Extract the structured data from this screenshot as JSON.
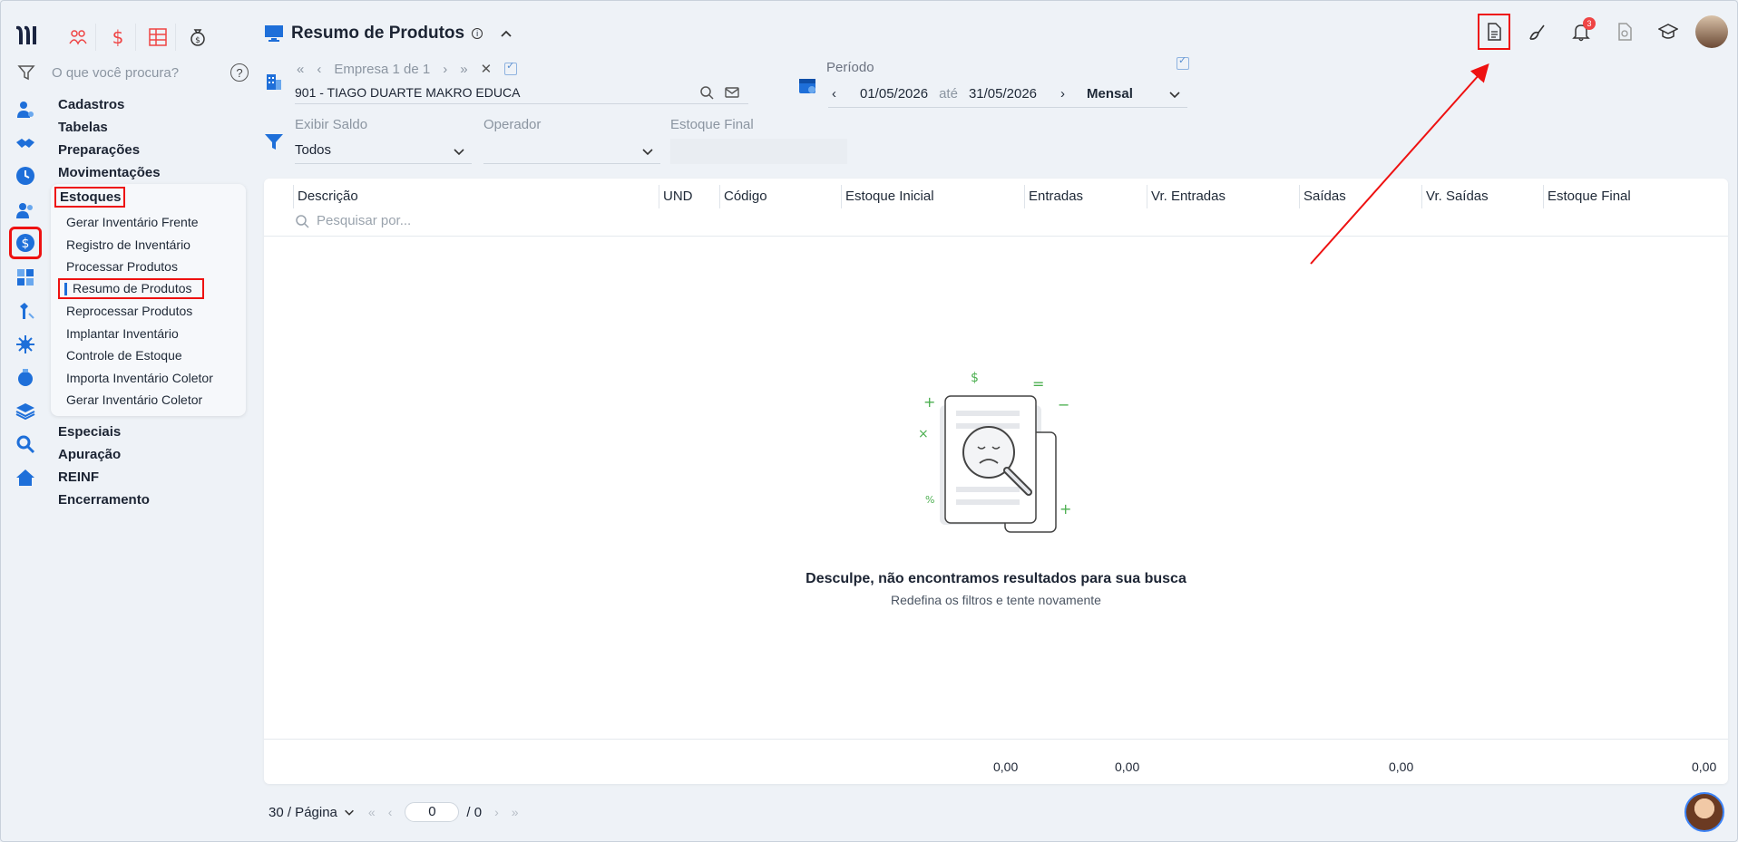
{
  "app": {
    "search_placeholder": "O que você procura?",
    "help": "?"
  },
  "menu": {
    "groups_top": [
      "Cadastros",
      "Tabelas",
      "Preparações",
      "Movimentações"
    ],
    "active_group": "Estoques",
    "submenu": [
      "Gerar Inventário Frente",
      "Registro de Inventário",
      "Processar Produtos",
      "Resumo de Produtos",
      "Reprocessar Produtos",
      "Implantar Inventário",
      "Controle de Estoque",
      "Importa Inventário Coletor",
      "Gerar Inventário Coletor"
    ],
    "active_sub_index": 3,
    "groups_bottom": [
      "Especiais",
      "Apuração",
      "REINF",
      "Encerramento"
    ]
  },
  "header": {
    "title": "Resumo de Produtos",
    "info": "i",
    "notifications_count": "3"
  },
  "empresa": {
    "nav_text": "Empresa 1 de 1",
    "value": "901 - TIAGO DUARTE MAKRO EDUCA"
  },
  "periodo": {
    "label": "Período",
    "from": "01/05/2026",
    "ate": "até",
    "to": "31/05/2026",
    "mode": "Mensal"
  },
  "filters": {
    "exibir_saldo_label": "Exibir Saldo",
    "exibir_saldo_value": "Todos",
    "operador_label": "Operador",
    "operador_value": "",
    "estoque_final_label": "Estoque Final"
  },
  "table": {
    "columns": [
      "Descrição",
      "UND",
      "Código",
      "Estoque Inicial",
      "Entradas",
      "Vr. Entradas",
      "Saídas",
      "Vr. Saídas",
      "Estoque Final"
    ],
    "search_placeholder": "Pesquisar por...",
    "empty_title": "Desculpe, não encontramos resultados para sua busca",
    "empty_subtitle": "Redefina os filtros e tente novamente",
    "totals": [
      "0,00",
      "0,00",
      "0,00",
      "0,00"
    ]
  },
  "pagination": {
    "per_page": "30 / Página",
    "page": "0",
    "total": "/ 0"
  },
  "colors": {
    "accent": "#1e6fd9",
    "highlight": "#e11111",
    "badge": "#ef4444"
  }
}
